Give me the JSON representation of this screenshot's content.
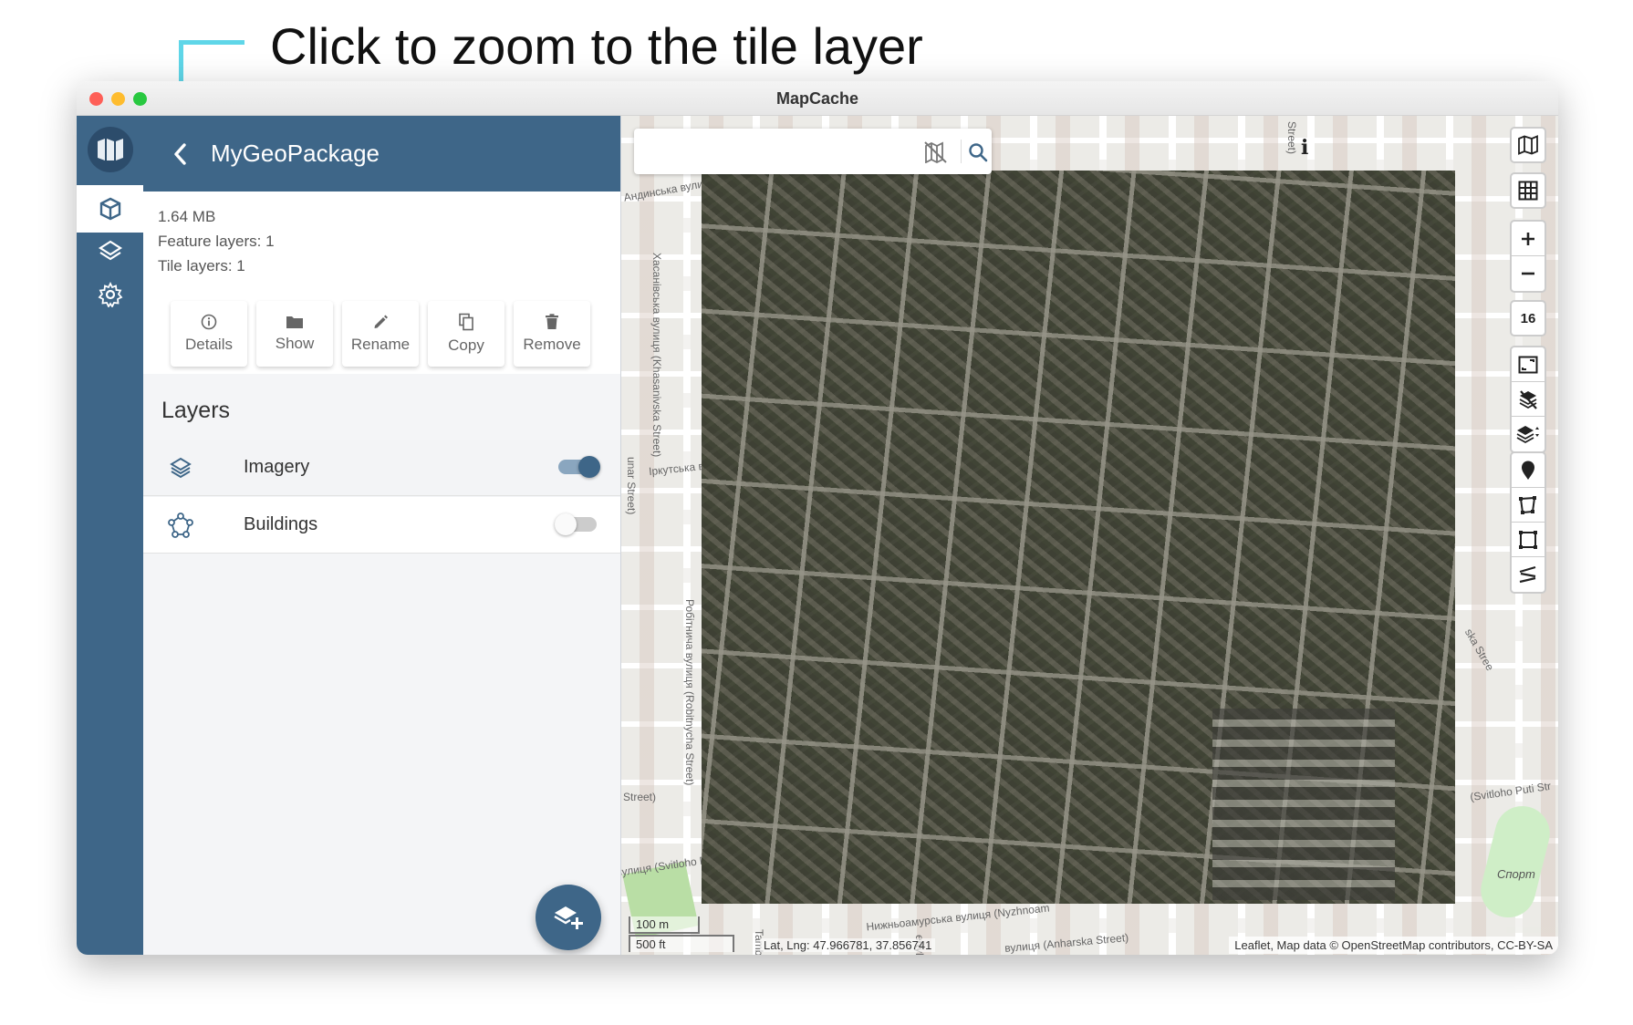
{
  "callout": {
    "text": "Click to zoom to the tile layer"
  },
  "window": {
    "title": "MapCache"
  },
  "rail": {
    "items": [
      {
        "icon": "cube-icon",
        "active": true
      },
      {
        "icon": "layers-icon",
        "active": false
      },
      {
        "icon": "gear-icon",
        "active": false
      }
    ]
  },
  "panel": {
    "title": "MyGeoPackage",
    "size": "1.64 MB",
    "feature_layers": "Feature layers: 1",
    "tile_layers": "Tile layers: 1",
    "actions": [
      {
        "label": "Details",
        "icon": "info-icon"
      },
      {
        "label": "Show",
        "icon": "folder-icon"
      },
      {
        "label": "Rename",
        "icon": "pencil-icon"
      },
      {
        "label": "Copy",
        "icon": "copy-icon"
      },
      {
        "label": "Remove",
        "icon": "trash-icon"
      }
    ],
    "layers_heading": "Layers",
    "layers": [
      {
        "name": "Imagery",
        "icon": "tile-layer-icon",
        "enabled": true
      },
      {
        "name": "Buildings",
        "icon": "feature-layer-icon",
        "enabled": false
      }
    ]
  },
  "map": {
    "search": {
      "value": "",
      "placeholder": ""
    },
    "zoom_level": "16",
    "scale_m": "100 m",
    "scale_ft": "500 ft",
    "coords": "Lat, Lng: 47.966781, 37.856741",
    "attribution": "Leaflet, Map data © OpenStreetMap contributors, CC-BY-SA",
    "info_mark": "i",
    "labels": {
      "street_1": "Хасанівська вулиця (Khasanivska Street)",
      "street_2": "Андинська вулиця",
      "street_3": "Іркутська в",
      "street_4": "Робітнича вулиця (Robitnycha Street)",
      "street_5": "Нижньоамурська вулиця (Nyzhnoam",
      "street_6": "вулиця (Svitloho P",
      "street_7": "(Svitloho Puti Str",
      "street_8": "вулиця (Anharska Street)",
      "street_9": "Street)",
      "street_10": "unar Street)",
      "street_11": "Street)",
      "street_12": "ska Stree",
      "street_13": "Tamb",
      "street_14": "ertyli",
      "stadium": "Спорт"
    }
  },
  "colors": {
    "primary": "#3e6688",
    "rail_dark": "#2c4c6b",
    "callout": "#5fd6e8",
    "toggle_track_on": "#8aa6bf"
  }
}
